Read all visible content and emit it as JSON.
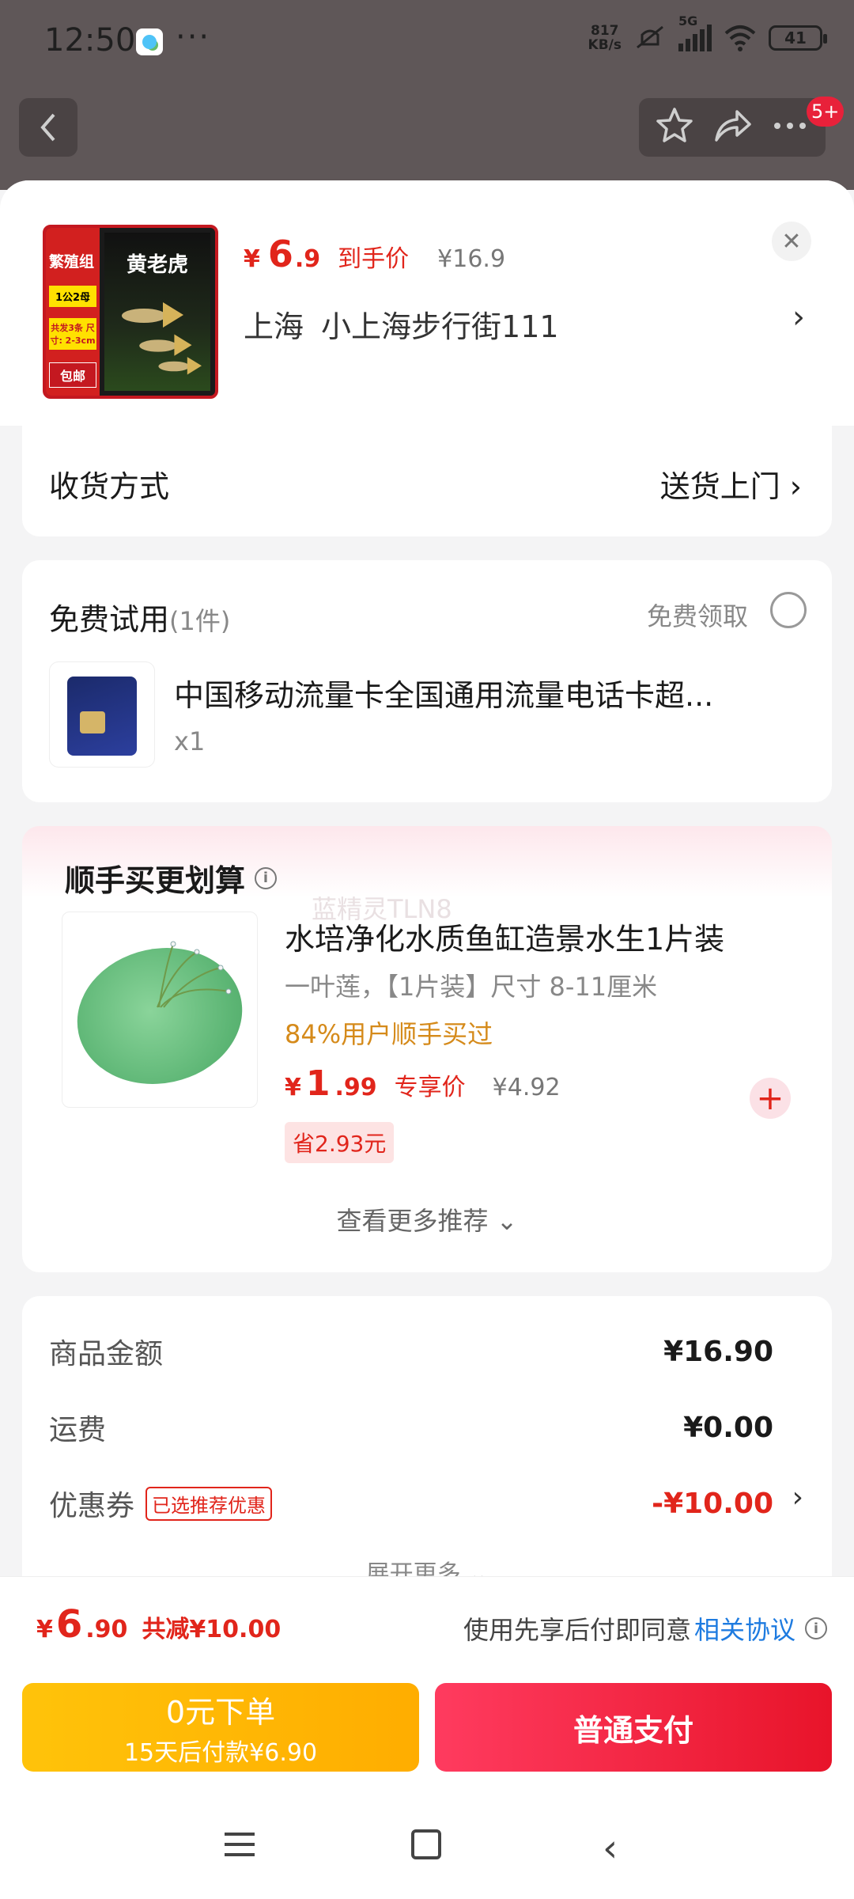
{
  "status_bar": {
    "time": "12:50",
    "dots": "···",
    "speed_value": "817",
    "speed_unit": "KB/s",
    "network": "5G",
    "battery": "41"
  },
  "top_nav": {
    "badge": "5+"
  },
  "header": {
    "thumb_tag_top": "繁殖组",
    "thumb_title": "黄老虎",
    "thumb_tag_pair": "1公2母",
    "thumb_tag_size": "共发3条 尺寸: 2-3cm",
    "thumb_tag_ship": "包邮",
    "price_symbol": "¥",
    "price_int": "6",
    "price_dec": ".9",
    "price_label": "到手价",
    "orig_price": "¥16.9",
    "address_city": "上海",
    "address_detail": "小上海步行街111"
  },
  "shipping": {
    "label": "收货方式",
    "value": "送货上门"
  },
  "free_trial": {
    "title": "免费试用",
    "count": "(1件)",
    "claim_label": "免费领取",
    "product_name": "中国移动流量卡全国通用流量电话卡超...",
    "quantity": "x1"
  },
  "recommend": {
    "title": "顺手买更划算",
    "watermark": "蓝精灵TLN8",
    "product_name": "水培净化水质鱼缸造景水生1片装",
    "spec": "一叶莲，【1片装】尺寸 8-11厘米",
    "bought_rate": "84%用户顺手买过",
    "price_symbol": "¥",
    "price_int": "1",
    "price_dec": ".99",
    "price_label": "专享价",
    "orig_price": "¥4.92",
    "save": "省2.93元",
    "more_label": "查看更多推荐 ⌄"
  },
  "summary": {
    "goods_label": "商品金额",
    "goods_value": "¥16.90",
    "freight_label": "运费",
    "freight_value": "¥0.00",
    "coupon_label": "优惠券",
    "coupon_tag": "已选推荐优惠",
    "coupon_value": "-¥10.00",
    "expand_label": "展开更多 ⌄"
  },
  "bottom_bar": {
    "price_symbol": "¥",
    "price_int": "6",
    "price_dec": ".90",
    "discount": "共减¥10.00",
    "agree_prefix": "使用先享后付即同意",
    "agree_link": "相关协议",
    "zero_order_title": "0元下单",
    "zero_order_sub": "15天后付款¥6.90",
    "pay_label": "普通支付"
  },
  "colors": {
    "accent_red": "#e1251b",
    "pay_red": "#e8142a",
    "zero_yellow": "#ffb300",
    "link_blue": "#1e7be0"
  }
}
